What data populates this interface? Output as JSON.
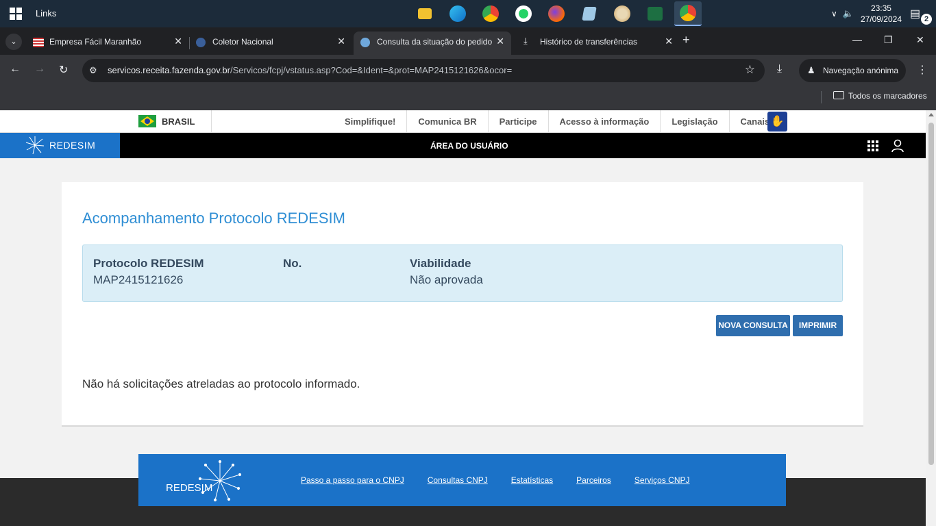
{
  "taskbar": {
    "links_label": "Links",
    "time": "23:35",
    "date": "27/09/2024",
    "notifications": "2"
  },
  "browser": {
    "tabs": [
      {
        "title": "Empresa Fácil Maranhão"
      },
      {
        "title": "Coletor Nacional"
      },
      {
        "title": "Consulta da situação do pedido"
      },
      {
        "title": "Histórico de transferências"
      }
    ],
    "url_host": "servicos.receita.fazenda.gov.br",
    "url_path": "/Servicos/fcpj/vstatus.asp?Cod=&Ident=&prot=MAP2415121626&ocor=",
    "incognito_label": "Navegação anónima",
    "all_bookmarks": "Todos os marcadores"
  },
  "govbar": {
    "country": "BRASIL",
    "links": [
      "Simplifique!",
      "Comunica BR",
      "Participe",
      "Acesso à informação",
      "Legislação",
      "Canais"
    ]
  },
  "header": {
    "logo_text": "REDESIM",
    "area_label": "ÁREA DO USUÁRIO"
  },
  "main": {
    "title": "Acompanhamento Protocolo REDESIM",
    "info": [
      {
        "label": "Protocolo REDESIM",
        "value": "MAP2415121626"
      },
      {
        "label": "No.",
        "value": ""
      },
      {
        "label": "Viabilidade",
        "value": "Não aprovada"
      }
    ],
    "buttons": {
      "new_query": "NOVA CONSULTA",
      "print": "IMPRIMIR"
    },
    "message": "Não há solicitações atreladas ao protocolo informado."
  },
  "footer": {
    "logo_text": "REDESIM",
    "links": [
      "Passo a passo para o CNPJ",
      "Consultas CNPJ",
      "Estatísticas",
      "Parceiros",
      "Serviços CNPJ"
    ]
  },
  "colors": {
    "brand_blue": "#1b72c8",
    "title_blue": "#2f8ed4",
    "button_blue": "#2f6eae",
    "info_bg": "#dbeef7"
  }
}
